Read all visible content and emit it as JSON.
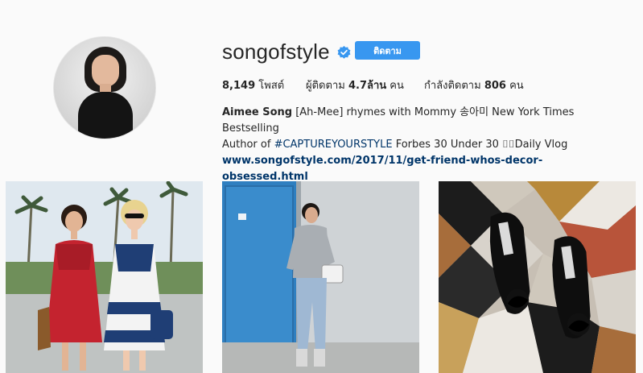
{
  "profile": {
    "username": "songofstyle",
    "verified": true,
    "follow_label": "ติดตาม",
    "stats": {
      "posts_value": "8,149",
      "posts_label": "โพสต์",
      "followers_label": "ผู้ติดตาม",
      "followers_value": "4.7ล้าน",
      "followers_unit": "คน",
      "following_label": "กำลังติดตาม",
      "following_value": "806",
      "following_unit": "คน"
    },
    "bio": {
      "name": "Aimee Song",
      "line1_rest": " [Ah-Mee] rhymes with Mommy 송아미 New York Times Bestselling",
      "line2_prefix": "Author of ",
      "hashtag": "#CAPTUREYOURSTYLE",
      "line2_rest": " Forbes 30 Under 30 ⌷⌷Daily Vlog",
      "link": "www.songofstyle.com/2017/11/get-friend-whos-decor-obsessed.html"
    }
  },
  "colors": {
    "accent": "#3897f0",
    "link": "#003569",
    "background": "#fafafa"
  },
  "posts": [
    {
      "icon": "dolls-photo"
    },
    {
      "icon": "blue-door-photo"
    },
    {
      "icon": "heels-on-tile-photo"
    }
  ]
}
